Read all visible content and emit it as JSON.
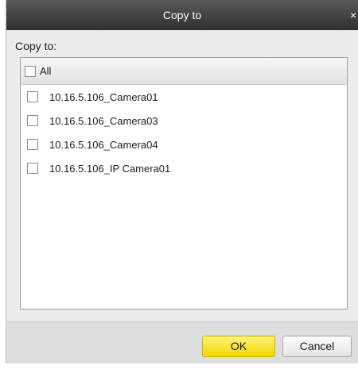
{
  "dialog": {
    "title": "Copy to",
    "close_glyph": "×",
    "label": "Copy to:",
    "select_all_label": "All",
    "items": [
      {
        "label": "10.16.5.106_Camera01",
        "checked": false
      },
      {
        "label": "10.16.5.106_Camera03",
        "checked": false
      },
      {
        "label": "10.16.5.106_Camera04",
        "checked": false
      },
      {
        "label": "10.16.5.106_IP Camera01",
        "checked": false
      }
    ],
    "ok_label": "OK",
    "cancel_label": "Cancel"
  },
  "colors": {
    "titlebar": "#3f3f3f",
    "ok_button": "#f4dd1a",
    "dialog_bg": "#ececec"
  }
}
